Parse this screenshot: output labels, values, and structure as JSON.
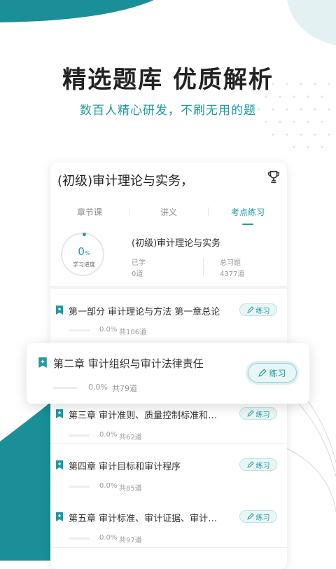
{
  "headline": "精选题库 优质解析",
  "subhead": "数百人精心研发，不刷无用的题",
  "card": {
    "title": "(初级)审计理论与实务，",
    "trophy_icon": "trophy-icon",
    "tabs": [
      {
        "label": "章节课",
        "active": false
      },
      {
        "label": "讲义",
        "active": false
      },
      {
        "label": "考点练习",
        "active": true
      }
    ],
    "progress": {
      "value": "0",
      "unit": "%",
      "label": "学习进度",
      "course_name": "(初级)审计理论与实务",
      "learned_label": "已学",
      "learned_value": "0道",
      "total_label": "总习题",
      "total_value": "4377道"
    },
    "practice_label": "练习",
    "chapters": [
      {
        "title": "第一部分 审计理论与方法 第一章总论",
        "pct": "0.0%",
        "count": "共106道"
      },
      {
        "title": "第三章 审计准则、质量控制标准和…",
        "pct": "0.0%",
        "count": "共62道"
      },
      {
        "title": "第四章 审计目标和审计程序",
        "pct": "0.0%",
        "count": "共85道"
      },
      {
        "title": "第五章 审计标准、审计证据、审计…",
        "pct": "0.0%",
        "count": "共97道"
      }
    ]
  },
  "popout": {
    "title": "第二章 审计组织与审计法律责任",
    "pct": "0.0%",
    "count": "共79道",
    "practice_label": "练习"
  },
  "colors": {
    "accent": "#1f9aa1",
    "background_shape": "#1a8f97"
  }
}
